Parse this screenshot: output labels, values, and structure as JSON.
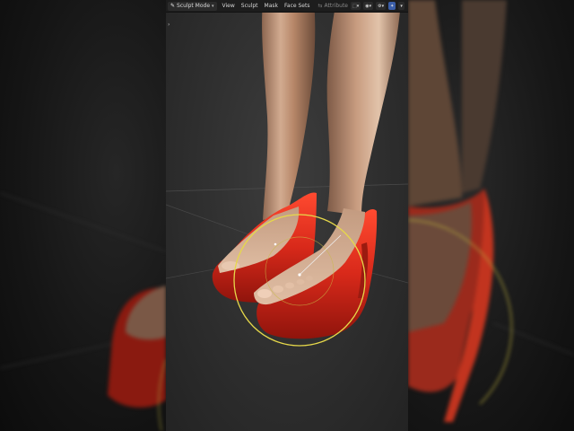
{
  "header": {
    "mode_label": "Sculpt Mode",
    "mode_icon": "brush-icon",
    "menus": [
      "View",
      "Sculpt",
      "Mask",
      "Face Sets"
    ],
    "attribute_label": "Attribute"
  },
  "colors": {
    "header_bg": "#1d1d1d",
    "viewport_bg": "#3d3d3d",
    "shoe_red": "#e0301e",
    "brush_circle": "#e6d84a",
    "skin": "#c79a7a"
  }
}
